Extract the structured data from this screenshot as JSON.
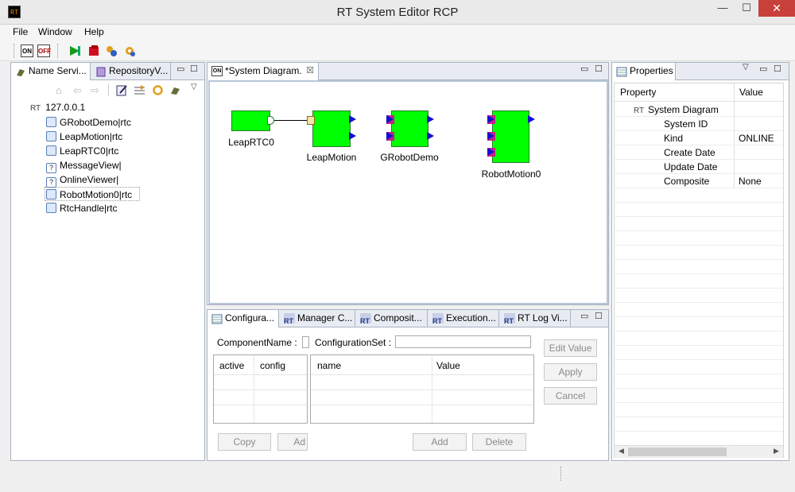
{
  "window": {
    "title": "RT System Editor RCP",
    "app_icon": "RT",
    "minimize": "—",
    "maximize": "☐",
    "close": "✕"
  },
  "menu": [
    "File",
    "Window",
    "Help"
  ],
  "toolbar": {
    "on_label": "ON",
    "off_label": "OFF"
  },
  "left_panel": {
    "tabs": [
      "Name Servi...",
      "RepositoryV..."
    ],
    "root": {
      "prefix": "RT",
      "label": "127.0.0.1"
    },
    "items": [
      {
        "label": "GRobotDemo|rtc",
        "icon": "rtc-icon"
      },
      {
        "label": "LeapMotion|rtc",
        "icon": "rtc-icon"
      },
      {
        "label": "LeapRTC0|rtc",
        "icon": "rtc-icon"
      },
      {
        "label": "MessageView|",
        "icon": "unknown-icon"
      },
      {
        "label": "OnlineViewer|",
        "icon": "unknown-icon"
      },
      {
        "label": "RobotMotion0|rtc",
        "icon": "rtc-icon"
      },
      {
        "label": "RtcHandle|rtc",
        "icon": "rtc-icon"
      }
    ]
  },
  "diagram": {
    "tab": "*System Diagram.",
    "tab_icon": "ON",
    "components": [
      "LeapRTC0",
      "LeapMotion",
      "GRobotDemo",
      "RobotMotion0"
    ]
  },
  "bottom": {
    "tabs": [
      "Configura...",
      "Manager C...",
      "Composit...",
      "Execution...",
      "RT Log Vi..."
    ],
    "component_name_label": "ComponentName :",
    "configuration_set_label": "ConfigurationSet :",
    "config_table": {
      "headers": [
        "active",
        "config"
      ]
    },
    "param_table": {
      "headers": [
        "name",
        "Value"
      ]
    },
    "buttons": {
      "edit_value": "Edit Value",
      "apply": "Apply",
      "cancel": "Cancel",
      "copy": "Copy",
      "add_left": "Ad",
      "add": "Add",
      "delete": "Delete"
    }
  },
  "properties": {
    "tab": "Properties",
    "headers": [
      "Property",
      "Value"
    ],
    "root": {
      "prefix": "RT",
      "label": "System Diagram"
    },
    "rows": [
      {
        "name": "System ID",
        "value": ""
      },
      {
        "name": "Kind",
        "value": "ONLINE"
      },
      {
        "name": "Create Date",
        "value": ""
      },
      {
        "name": "Update Date",
        "value": ""
      },
      {
        "name": "Composite",
        "value": "None"
      }
    ]
  }
}
